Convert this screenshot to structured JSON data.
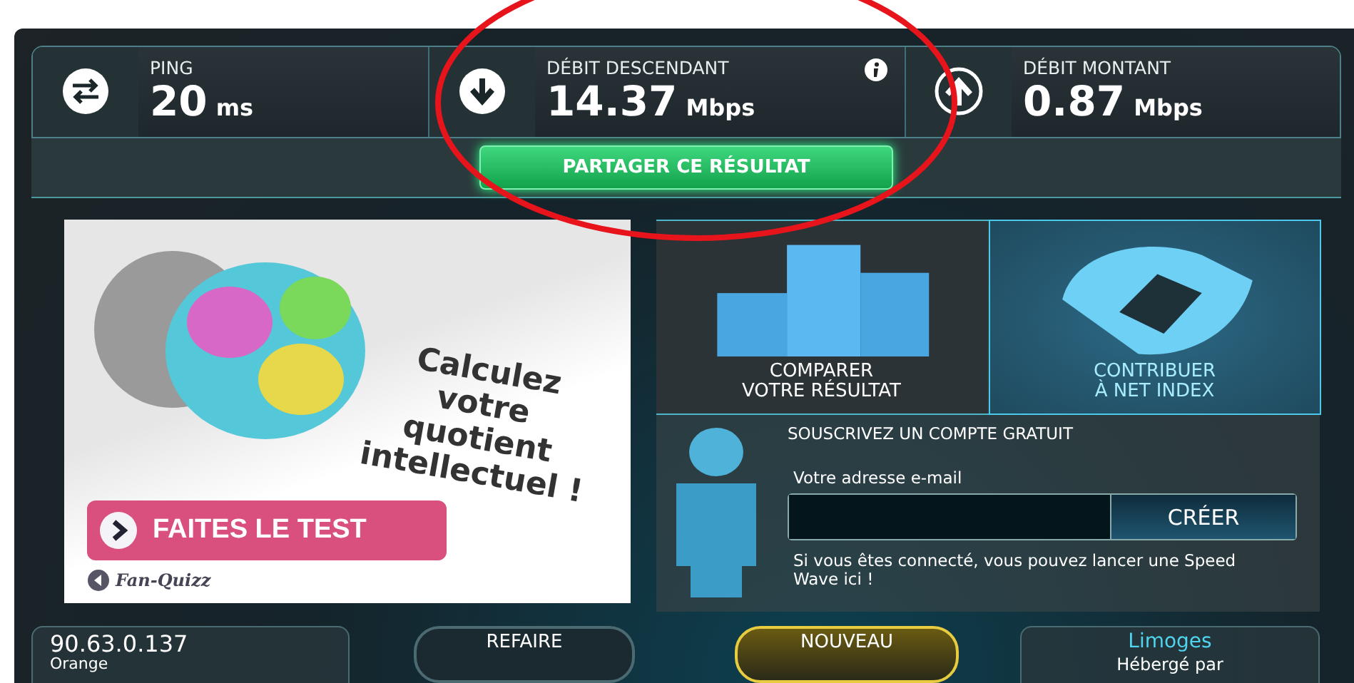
{
  "stats": [
    {
      "kind": "ping",
      "label": "PING",
      "value": "20",
      "unit": "ms"
    },
    {
      "kind": "download",
      "label": "DÉBIT DESCENDANT",
      "value": "14.37",
      "unit": "Mbps",
      "info": true
    },
    {
      "kind": "upload",
      "label": "DÉBIT MONTANT",
      "value": "0.87",
      "unit": "Mbps"
    }
  ],
  "share_button": "PARTAGER CE RÉSULTAT",
  "ad": {
    "headline": "Calculez votre quotient intellectuel !",
    "button": "FAITES LE TEST",
    "brand": "Fan-Quizz"
  },
  "tiles": [
    {
      "kind": "compare",
      "lines": [
        "COMPARER",
        "VOTRE RÉSULTAT"
      ],
      "selected": false
    },
    {
      "kind": "contribute",
      "lines": [
        "CONTRIBUER",
        "À NET INDEX"
      ],
      "selected": true
    }
  ],
  "signup": {
    "title": "SOUSCRIVEZ UN COMPTE GRATUIT",
    "email_label": "Votre adresse e-mail",
    "button": "CRÉER",
    "note": "Si vous êtes connecté, vous pouvez lancer une Speed Wave ici !"
  },
  "bottom": {
    "ip": "90.63.0.137",
    "isp": "Orange",
    "retest": "REFAIRE",
    "new_server": "NOUVEAU",
    "server_city": "Limoges",
    "hosted_by": "Hébergé par"
  }
}
